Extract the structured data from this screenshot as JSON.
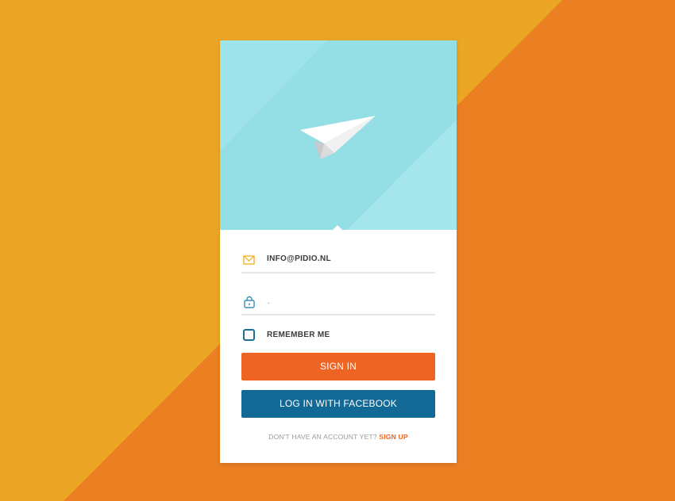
{
  "colors": {
    "background_yellow": "#eca625",
    "background_orange": "#ec7f22",
    "hero_blue": "#94dfe6",
    "signin_button": "#ee6523",
    "facebook_button": "#136996",
    "signup_link": "#ee6523"
  },
  "hero": {
    "icon": "paper-plane-icon"
  },
  "form": {
    "email": {
      "icon": "envelope-icon",
      "value": "INFO@PIDIO.NL"
    },
    "password": {
      "icon": "lock-icon",
      "masked_value": "•"
    },
    "remember": {
      "label": "REMEMBER ME",
      "checked": false
    },
    "signin_label": "SIGN IN",
    "facebook_label": "LOG IN WITH FACEBOOK"
  },
  "footer": {
    "prompt": "DON'T HAVE AN ACCOUNT YET?",
    "signup_label": "SIGN UP"
  }
}
